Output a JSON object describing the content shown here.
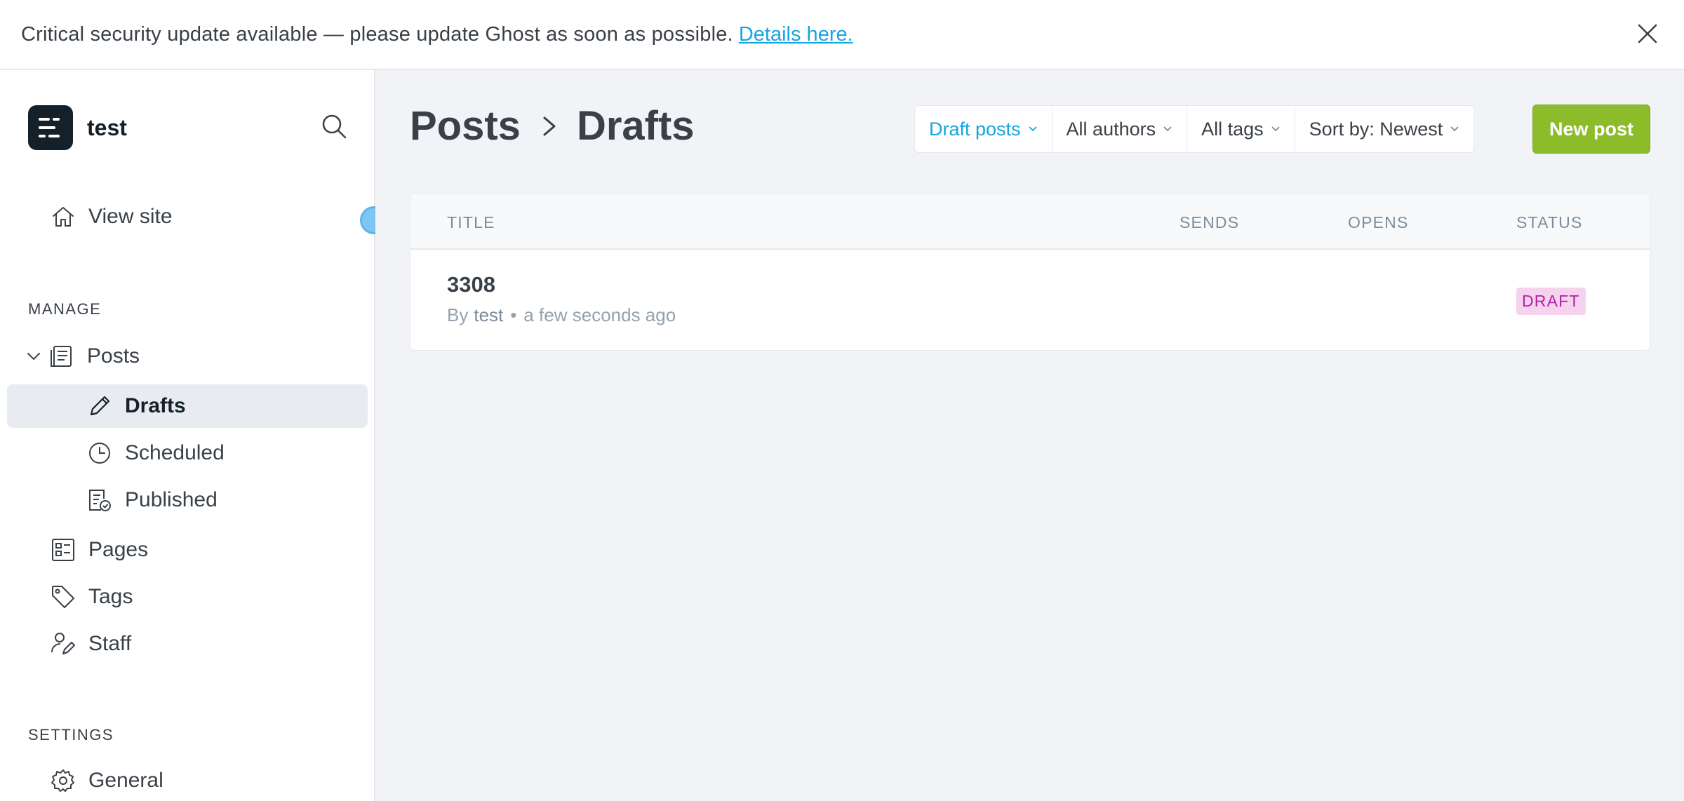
{
  "banner": {
    "message": "Critical security update available — please update Ghost as soon as possible.",
    "link_label": "Details here."
  },
  "sidebar": {
    "site_name": "test",
    "view_site_label": "View site",
    "manage_heading": "MANAGE",
    "settings_heading": "SETTINGS",
    "items": {
      "posts": "Posts",
      "drafts": "Drafts",
      "scheduled": "Scheduled",
      "published": "Published",
      "pages": "Pages",
      "tags": "Tags",
      "staff": "Staff",
      "general": "General"
    }
  },
  "header": {
    "breadcrumb_parent": "Posts",
    "breadcrumb_current": "Drafts",
    "filters": {
      "type": "Draft posts",
      "authors": "All authors",
      "tags": "All tags",
      "sort": "Sort by: Newest"
    },
    "new_post_label": "New post"
  },
  "table": {
    "columns": {
      "title": "TITLE",
      "sends": "SENDS",
      "opens": "OPENS",
      "status": "STATUS"
    },
    "rows": [
      {
        "title": "3308",
        "by_label": "By",
        "author": "test",
        "time": "a few seconds ago",
        "status": "DRAFT"
      }
    ]
  },
  "colors": {
    "accent_blue": "#14a5e0",
    "primary_green": "#8dbc2b",
    "draft_badge_text": "#b620a8",
    "draft_badge_bg": "#f5d3ef",
    "main_bg": "#f1f3f6"
  }
}
